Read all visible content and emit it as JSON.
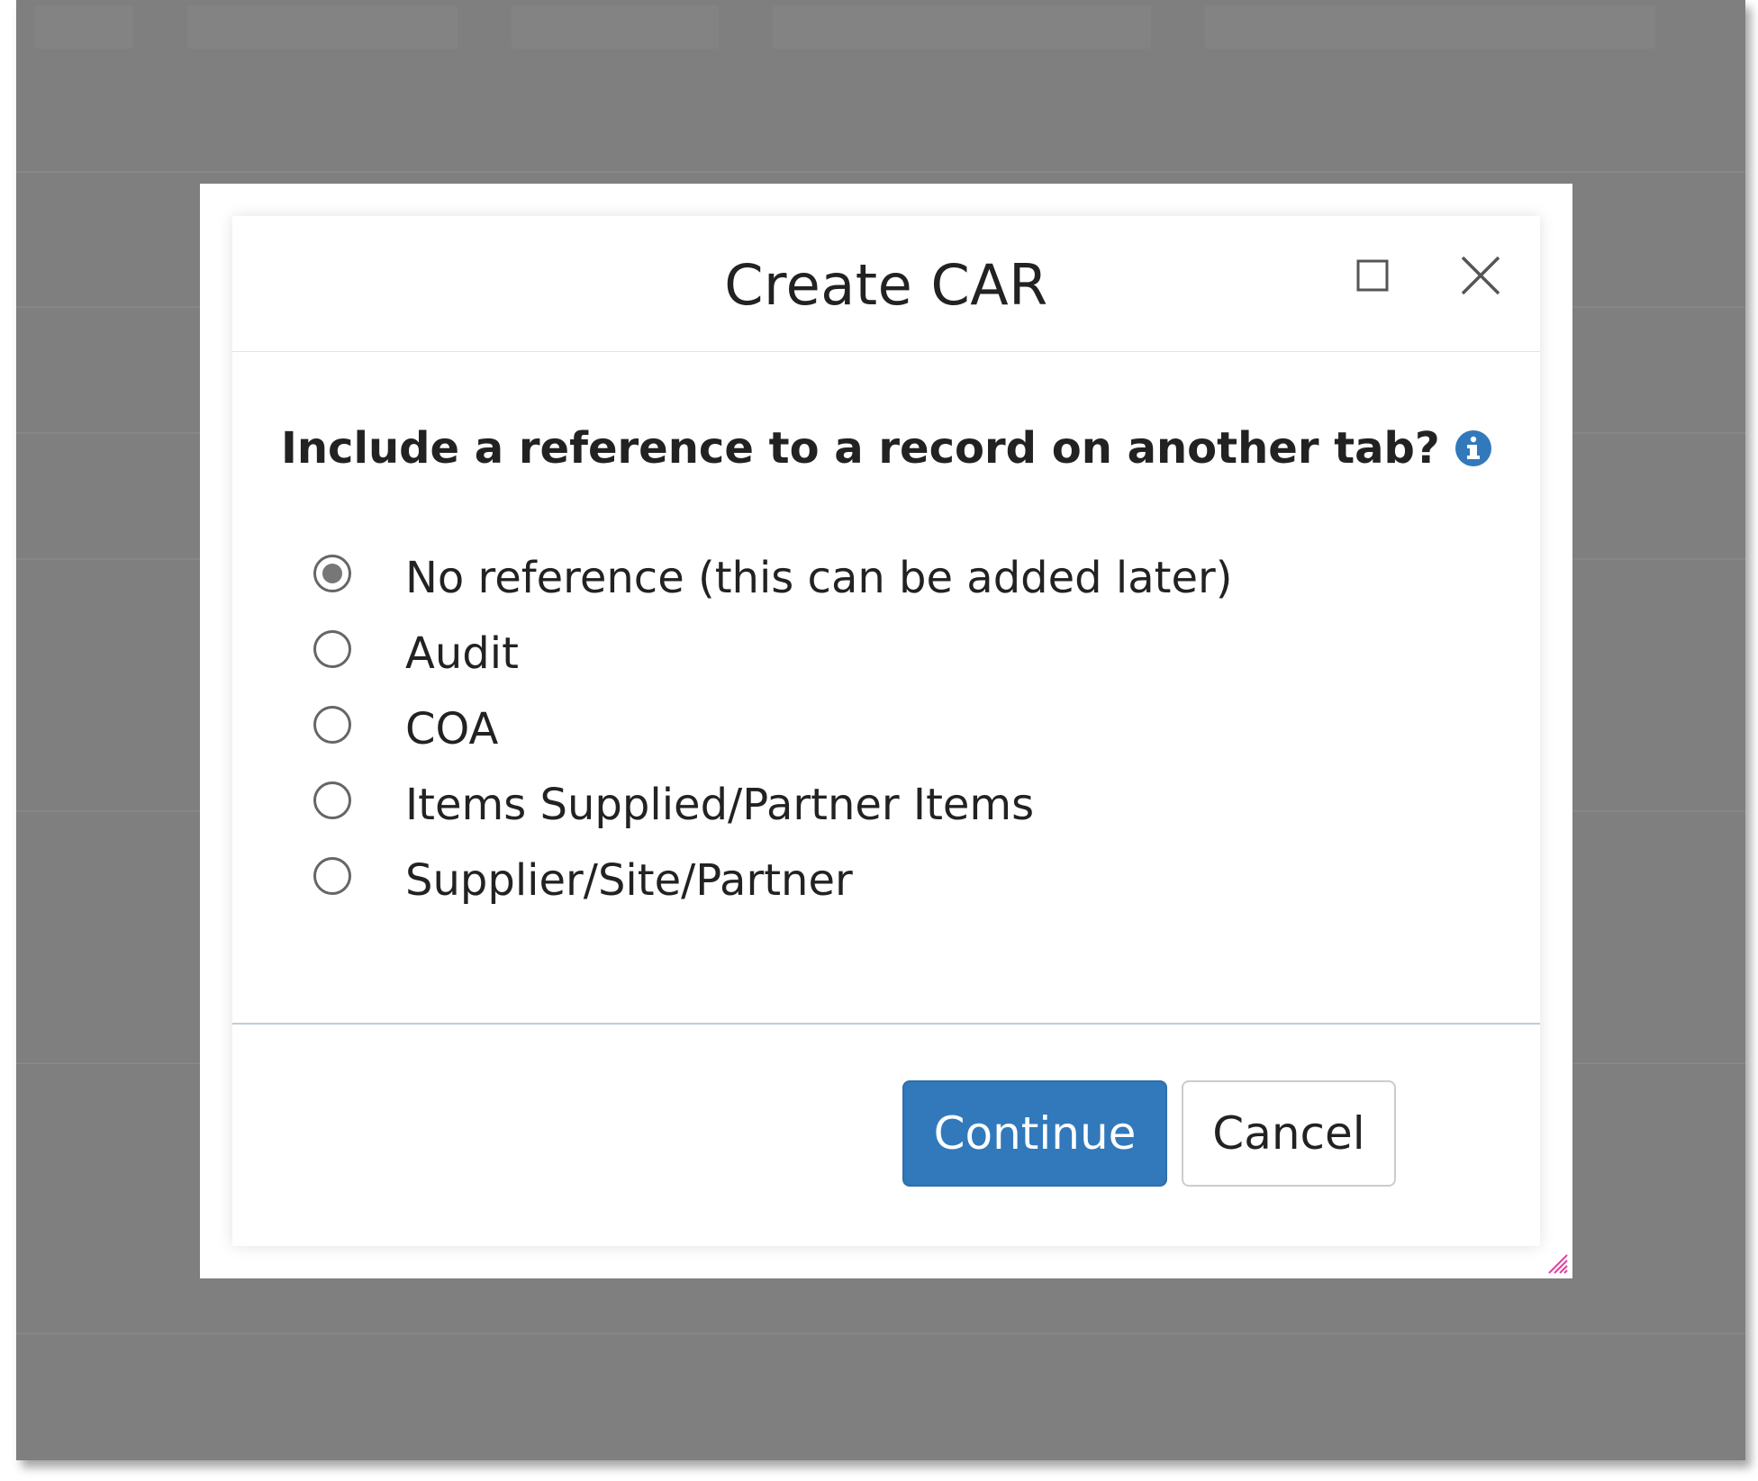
{
  "dialog": {
    "title": "Create CAR",
    "question": "Include a reference to a record on another tab?",
    "options": [
      {
        "label": "No reference (this can be added later)",
        "selected": true
      },
      {
        "label": "Audit",
        "selected": false
      },
      {
        "label": "COA",
        "selected": false
      },
      {
        "label": "Items Supplied/Partner Items",
        "selected": false
      },
      {
        "label": "Supplier/Site/Partner",
        "selected": false
      }
    ],
    "continue_label": "Continue",
    "cancel_label": "Cancel"
  },
  "icons": {
    "maximize": "maximize-icon",
    "close": "close-icon",
    "info": "info-icon",
    "resize": "resize-handle-icon"
  },
  "colors": {
    "primary_button": "#3179bb",
    "info_icon": "#3179bb",
    "overlay": "#7f7f7f",
    "footer_divider": "#b9cfdd",
    "resize_handle": "#e040a0"
  }
}
